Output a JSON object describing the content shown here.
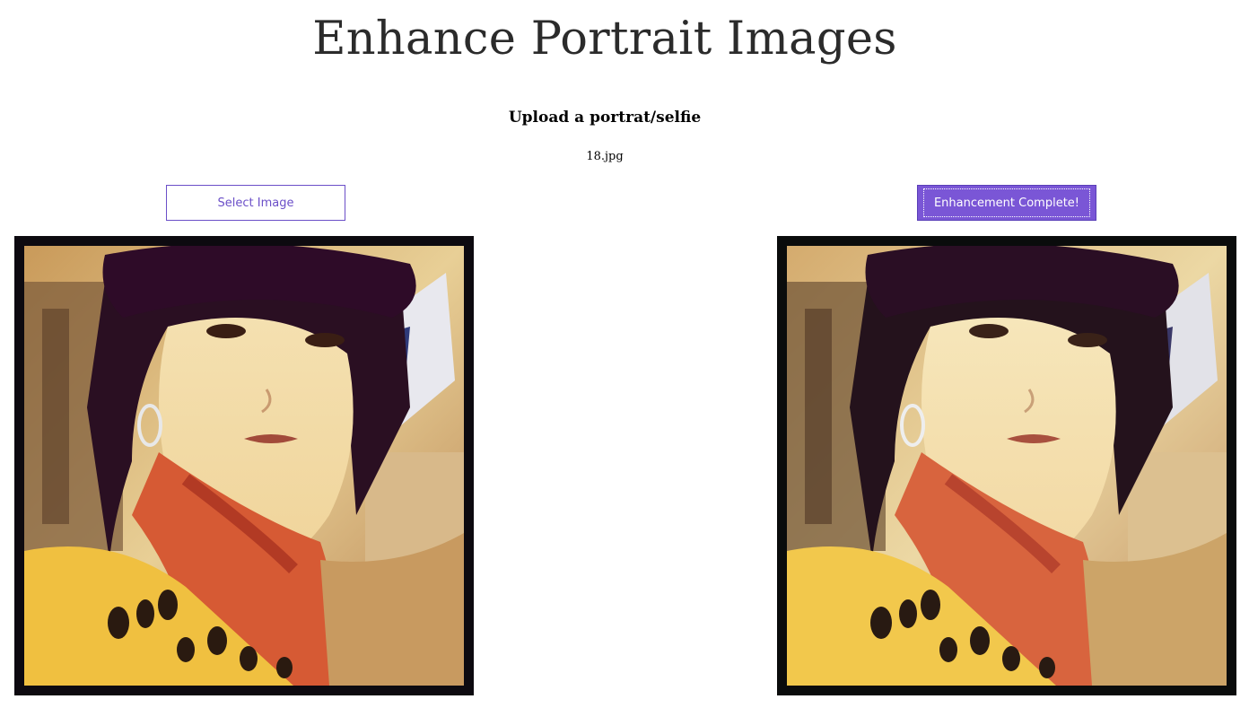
{
  "page": {
    "title": "Enhance Portrait Images",
    "subtitle": "Upload a portrat/selfie",
    "filename": "18.jpg"
  },
  "buttons": {
    "select_label": "Select Image",
    "enhance_label": "Enhancement Complete!"
  },
  "images": {
    "original": {
      "alt": "uploaded portrait"
    },
    "enhanced": {
      "alt": "enhanced portrait"
    }
  },
  "colors": {
    "accent": "#7a56d6",
    "accent_border": "#6b4fc8"
  }
}
